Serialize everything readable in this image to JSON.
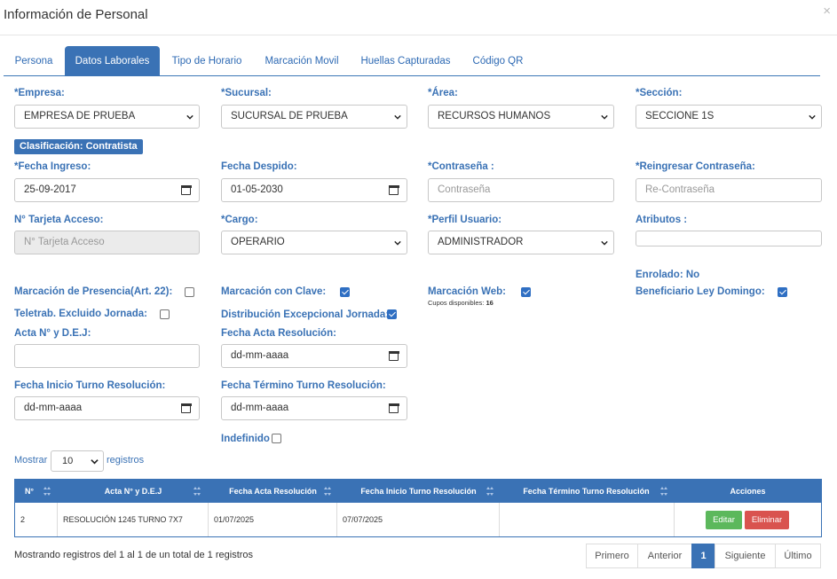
{
  "modal": {
    "title": "Información de Personal",
    "close": "×"
  },
  "tabs": [
    "Persona",
    "Datos Laborales",
    "Tipo de Horario",
    "Marcación Movil",
    "Huellas Capturadas",
    "Código QR"
  ],
  "row1": {
    "empresa": {
      "label": "*Empresa:",
      "value": "EMPRESA DE PRUEBA"
    },
    "sucursal": {
      "label": "*Sucursal:",
      "value": "SUCURSAL DE PRUEBA"
    },
    "area": {
      "label": "*Área:",
      "value": "RECURSOS HUMANOS"
    },
    "seccion": {
      "label": "*Sección:",
      "value": "SECCIONE 1S"
    }
  },
  "clasificacion": "Clasificación: Contratista",
  "row2": {
    "fecha_ingreso": {
      "label": "*Fecha Ingreso:",
      "value": "25-09-2017"
    },
    "fecha_despido": {
      "label": "Fecha Despido:",
      "value": "01-05-2030"
    },
    "contrasena": {
      "label": "*Contraseña :",
      "placeholder": "Contraseña"
    },
    "recontrasena": {
      "label": "*Reingresar Contraseña:",
      "placeholder": "Re-Contraseña"
    }
  },
  "row3": {
    "tarjeta": {
      "label": "N° Tarjeta Acceso:",
      "placeholder": "N° Tarjeta Acceso"
    },
    "cargo": {
      "label": "*Cargo:",
      "value": "OPERARIO"
    },
    "perfil": {
      "label": "*Perfil Usuario:",
      "value": "ADMINISTRADOR"
    },
    "atributos": {
      "label": "Atributos :"
    }
  },
  "checks": {
    "enrolado": "Enrolado: No",
    "presencia": {
      "label": "Marcación de Presencia(Art. 22):",
      "checked": false
    },
    "clave": {
      "label": "Marcación con Clave:",
      "checked": true
    },
    "web": {
      "label": "Marcación Web:",
      "checked": true,
      "cupos_label": "Cupos disponibles:",
      "cupos_value": "16"
    },
    "ley_domingo": {
      "label": "Beneficiario Ley Domingo:",
      "checked": true
    },
    "teletrab": {
      "label": "Teletrab. Excluido Jornada:",
      "checked": false
    },
    "distribucion": {
      "label": "Distribución Excepcional Jornada:",
      "checked": true
    }
  },
  "row4": {
    "acta": {
      "label": "Acta N° y D.E.J:",
      "value": ""
    },
    "fecha_acta": {
      "label": "Fecha Acta Resolución:",
      "value": "dd-mm-aaaa"
    }
  },
  "row5": {
    "fecha_inicio": {
      "label": "Fecha Inicio Turno Resolución:",
      "value": "dd-mm-aaaa"
    },
    "fecha_termino": {
      "label": "Fecha Término Turno Resolución:",
      "value": "dd-mm-aaaa"
    },
    "indefinido": {
      "label": "Indefinido",
      "checked": false
    }
  },
  "length_menu": {
    "before": "Mostrar",
    "value": "10",
    "after": "registros"
  },
  "table": {
    "headers": [
      "N°",
      "Acta N° y D.E.J",
      "Fecha Acta Resolución",
      "Fecha Inicio Turno Resolución",
      "Fecha Término Turno Resolución",
      "Acciones"
    ],
    "rows": [
      {
        "n": "2",
        "acta": "RESOLUCIÓN 1245 TURNO 7X7",
        "fecha_acta": "01/07/2025",
        "fecha_inicio": "07/07/2025",
        "fecha_termino": ""
      }
    ],
    "edit_label": "Editar",
    "delete_label": "Eliminar"
  },
  "info": "Mostrando registros del 1 al 1 de un total de 1 registros",
  "pagination": {
    "first": "Primero",
    "prev": "Anterior",
    "current": "1",
    "next": "Siguiente",
    "last": "Último"
  },
  "colors": {
    "primary": "#3a72b5",
    "success": "#5cb85c",
    "danger": "#d9534f",
    "checkbox": "#2f6fc3"
  }
}
